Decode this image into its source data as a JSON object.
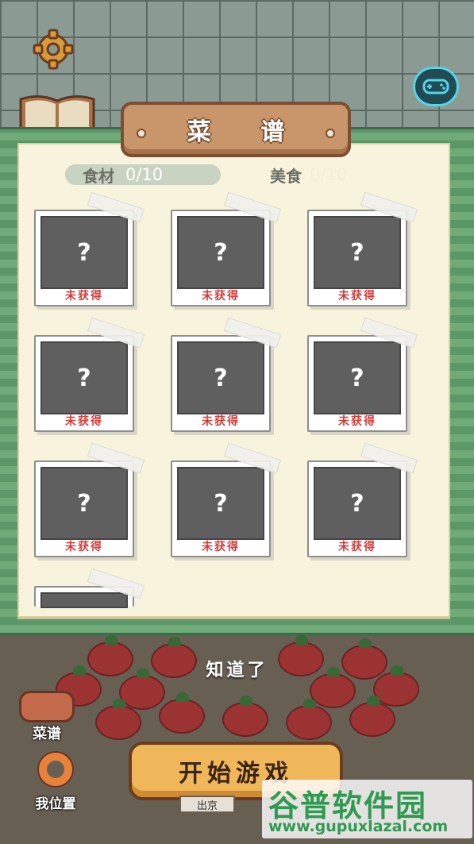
{
  "header": {
    "title": "菜 谱"
  },
  "counters": {
    "ingredients_label": "食材",
    "ingredients_value": "0/10",
    "dishes_label": "美食",
    "dishes_value": "0/10"
  },
  "cards": [
    {
      "mark": "?",
      "status": "未获得"
    },
    {
      "mark": "?",
      "status": "未获得"
    },
    {
      "mark": "?",
      "status": "未获得"
    },
    {
      "mark": "?",
      "status": "未获得"
    },
    {
      "mark": "?",
      "status": "未获得"
    },
    {
      "mark": "?",
      "status": "未获得"
    },
    {
      "mark": "?",
      "status": "未获得"
    },
    {
      "mark": "?",
      "status": "未获得"
    },
    {
      "mark": "?",
      "status": "未获得"
    }
  ],
  "overlay": {
    "dismiss_text": "知道了"
  },
  "bottom": {
    "recipe_label": "菜谱",
    "location_label": "我位置",
    "start_label": "开始游戏",
    "sign_text": "出京"
  },
  "watermark": {
    "title": "谷普软件园",
    "url": "www.gupuxlazal.com"
  },
  "colors": {
    "stripe_green": "#6faa78",
    "paper": "#f8f3dd",
    "status_red": "#d33b3b",
    "accent_cyan": "#52d6e6"
  }
}
